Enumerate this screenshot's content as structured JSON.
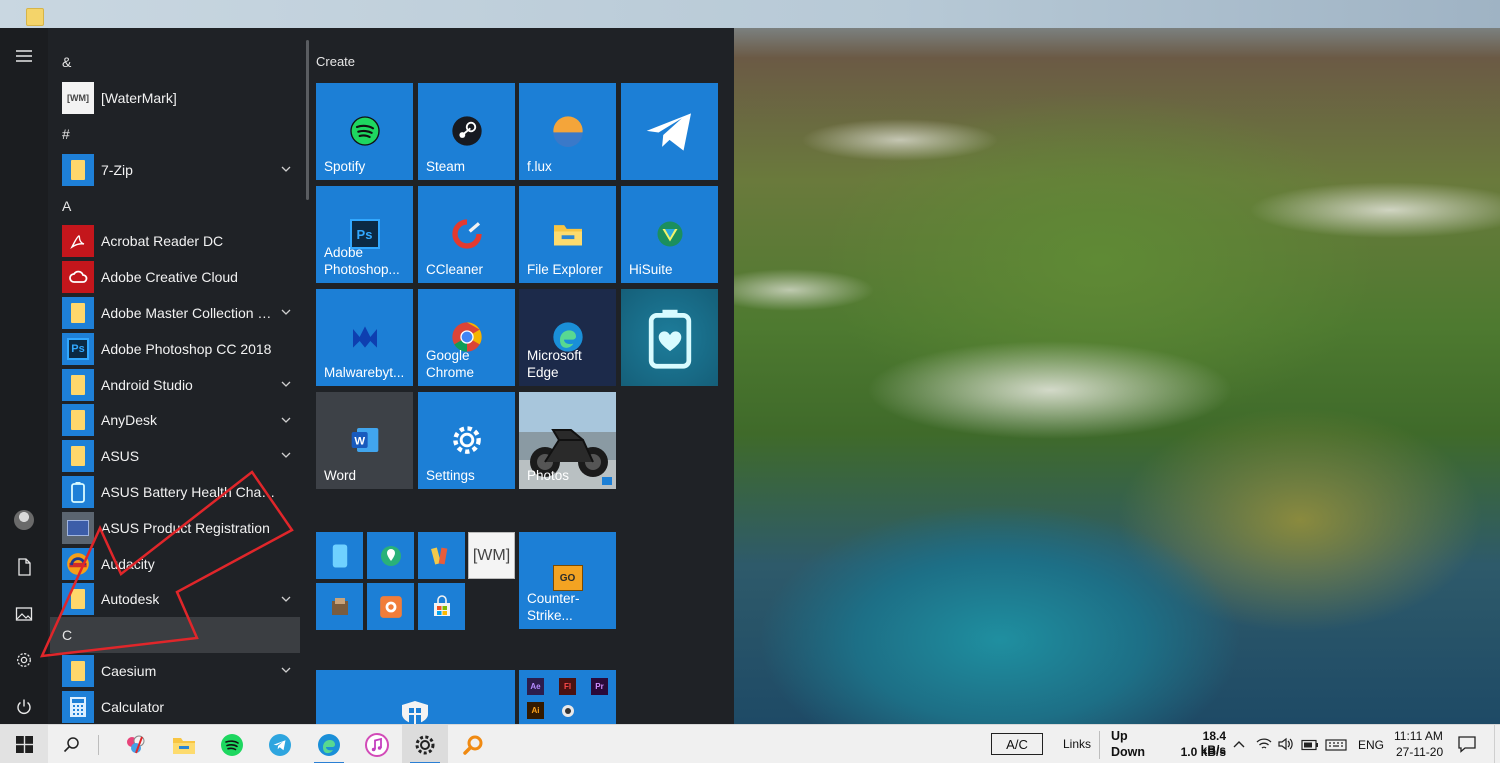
{
  "desktop": {
    "wallpaper": "Big Sur coastline landscape"
  },
  "start_menu": {
    "rail": {
      "items": [
        {
          "name": "hamburger-menu-icon"
        },
        {
          "name": "user-avatar"
        },
        {
          "name": "documents-icon"
        },
        {
          "name": "pictures-icon"
        },
        {
          "name": "settings-gear-icon"
        },
        {
          "name": "power-icon"
        }
      ]
    },
    "app_list": {
      "entries": [
        {
          "type": "letter",
          "label": "&"
        },
        {
          "type": "app",
          "label": "[WaterMark]",
          "icon": "watermark-icon",
          "icon_text": "[WM]"
        },
        {
          "type": "letter",
          "label": "#"
        },
        {
          "type": "app",
          "label": "7-Zip",
          "icon": "folder-icon",
          "expandable": true
        },
        {
          "type": "letter",
          "label": "A"
        },
        {
          "type": "app",
          "label": "Acrobat Reader DC",
          "icon": "acrobat-icon"
        },
        {
          "type": "app",
          "label": "Adobe Creative Cloud",
          "icon": "creative-cloud-icon"
        },
        {
          "type": "app",
          "label": "Adobe Master Collection C...",
          "icon": "folder-icon",
          "expandable": true
        },
        {
          "type": "app",
          "label": "Adobe Photoshop CC 2018",
          "icon": "photoshop-icon",
          "icon_text": "Ps"
        },
        {
          "type": "app",
          "label": "Android Studio",
          "icon": "folder-icon",
          "expandable": true
        },
        {
          "type": "app",
          "label": "AnyDesk",
          "icon": "folder-icon",
          "expandable": true
        },
        {
          "type": "app",
          "label": "ASUS",
          "icon": "folder-icon",
          "expandable": true
        },
        {
          "type": "app",
          "label": "ASUS Battery Health Charging",
          "icon": "battery-health-icon"
        },
        {
          "type": "app",
          "label": "ASUS Product Registration",
          "icon": "asus-registration-icon"
        },
        {
          "type": "app",
          "label": "Audacity",
          "icon": "audacity-icon"
        },
        {
          "type": "app",
          "label": "Autodesk",
          "icon": "folder-icon",
          "expandable": true
        },
        {
          "type": "letter",
          "label": "C",
          "highlighted": true
        },
        {
          "type": "app",
          "label": "Caesium",
          "icon": "folder-icon",
          "expandable": true
        },
        {
          "type": "app",
          "label": "Calculator",
          "icon": "calculator-icon"
        }
      ]
    },
    "tiles": {
      "group_label": "Create",
      "large": [
        {
          "label": "Spotify",
          "icon": "spotify-icon",
          "style": "blue"
        },
        {
          "label": "Steam",
          "icon": "steam-icon",
          "style": "blue"
        },
        {
          "label": "f.lux",
          "icon": "flux-icon",
          "style": "blue"
        },
        {
          "label": "",
          "icon": "telegram-icon",
          "style": "blue"
        },
        {
          "label": "Adobe\nPhotoshop...",
          "icon": "photoshop-icon",
          "style": "blue"
        },
        {
          "label": "CCleaner",
          "icon": "ccleaner-icon",
          "style": "blue"
        },
        {
          "label": "File Explorer",
          "icon": "file-explorer-icon",
          "style": "blue"
        },
        {
          "label": "HiSuite",
          "icon": "hisuite-icon",
          "style": "blue"
        },
        {
          "label": "Malwarebyt...",
          "icon": "malwarebytes-icon",
          "style": "blue"
        },
        {
          "label": "Google\nChrome",
          "icon": "chrome-icon",
          "style": "gray"
        },
        {
          "label": "Microsoft\nEdge",
          "icon": "edge-icon",
          "style": "navy"
        },
        {
          "label": "",
          "icon": "battery-health-icon",
          "style": "teal"
        },
        {
          "label": "Word",
          "icon": "word-icon",
          "style": "dark"
        },
        {
          "label": "Settings",
          "icon": "settings-icon",
          "style": "blue"
        },
        {
          "label": "Photos",
          "icon": "photos-icon",
          "style": "photo"
        }
      ],
      "small": [
        {
          "icon": "phone-icon"
        },
        {
          "icon": "maps-icon"
        },
        {
          "icon": "media-icon"
        },
        {
          "icon": "watermark-icon",
          "text": "[WM]"
        },
        {
          "icon": "tool-icon"
        },
        {
          "icon": "record-icon"
        },
        {
          "icon": "store-icon"
        }
      ],
      "counter_strike": {
        "label": "Counter-\nStrike...",
        "icon": "csgo-icon",
        "icon_text": "GO"
      },
      "bottom": [
        {
          "icon": "windows-security-icon"
        },
        {
          "icon": "adobe-apps-group-icon",
          "mini": [
            "Ae",
            "Fl",
            "Pr",
            "Ai"
          ]
        }
      ]
    }
  },
  "taskbar": {
    "pinned": [
      {
        "name": "start-button"
      },
      {
        "name": "search-icon"
      },
      {
        "name": "paint-icon"
      },
      {
        "name": "file-explorer-icon"
      },
      {
        "name": "spotify-icon"
      },
      {
        "name": "telegram-icon"
      },
      {
        "name": "edge-icon"
      },
      {
        "name": "itunes-icon"
      },
      {
        "name": "settings-icon",
        "active": true
      },
      {
        "name": "search-magnifier-icon"
      }
    ],
    "tray": {
      "ac_label": "A/C",
      "links_label": "Links",
      "up_label": "Up",
      "down_label": "Down",
      "up_speed": "18.4 kB/s",
      "down_speed": "1.0 kB/s",
      "language": "ENG",
      "time": "11:11 AM",
      "date": "27-11-20"
    }
  },
  "colors": {
    "tile_blue": "#1c7fd6",
    "start_bg": "#1f2226",
    "taskbar_bg": "#f0f0f0",
    "annotation_red": "#e0262a"
  }
}
